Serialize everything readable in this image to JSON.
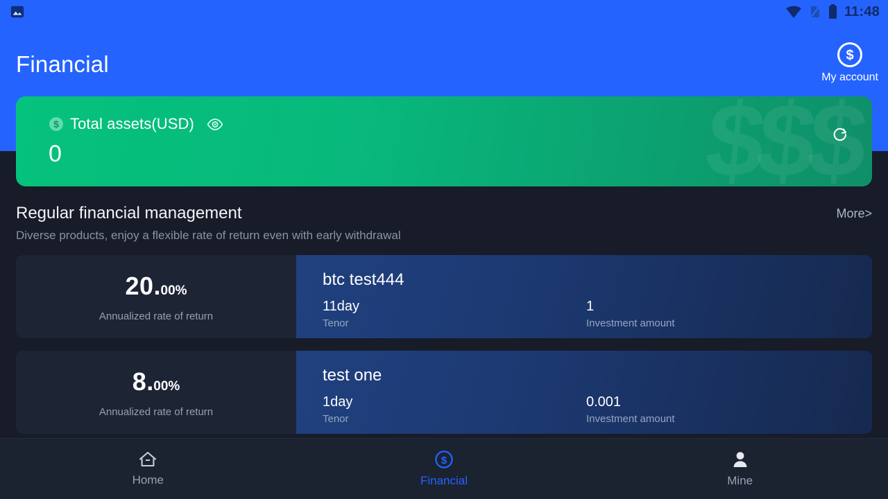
{
  "statusbar": {
    "time": "11:48",
    "icons": [
      "image-icon",
      "wifi-icon",
      "no-sim-icon",
      "battery-icon"
    ]
  },
  "header": {
    "title": "Financial",
    "account_label": "My account",
    "account_icon": "dollar-circle-icon"
  },
  "balance_card": {
    "coin_icon": "dollar-coin-icon",
    "label": "Total assets(USD)",
    "eye_icon": "eye-visible-icon",
    "amount": "0",
    "refresh_icon": "refresh-icon",
    "watermark": "$$$",
    "gradient_from": "#05c27c",
    "gradient_to": "#0f8f68"
  },
  "section": {
    "title": "Regular financial management",
    "subtitle": "Diverse products, enjoy a flexible rate of return even with early withdrawal",
    "more_label": "More>"
  },
  "products": [
    {
      "rate_int": "20",
      "rate_dot": ".",
      "rate_dec": "00%",
      "rate_caption": "Annualized rate of return",
      "name": "btc test444",
      "tenor_value": "11day",
      "tenor_label": "Tenor",
      "amount_value": "1",
      "amount_label": "Investment amount"
    },
    {
      "rate_int": "8",
      "rate_dot": ".",
      "rate_dec": "00%",
      "rate_caption": "Annualized rate of return",
      "name": "test one",
      "tenor_value": "1day",
      "tenor_label": "Tenor",
      "amount_value": "0.001",
      "amount_label": "Investment amount"
    }
  ],
  "bottom_nav": {
    "active_color": "#2563ff",
    "items": [
      {
        "label": "Home",
        "icon": "home-icon",
        "active": false
      },
      {
        "label": "Financial",
        "icon": "dollar-circle-icon",
        "active": true
      },
      {
        "label": "Mine",
        "icon": "person-icon",
        "active": false
      }
    ]
  }
}
